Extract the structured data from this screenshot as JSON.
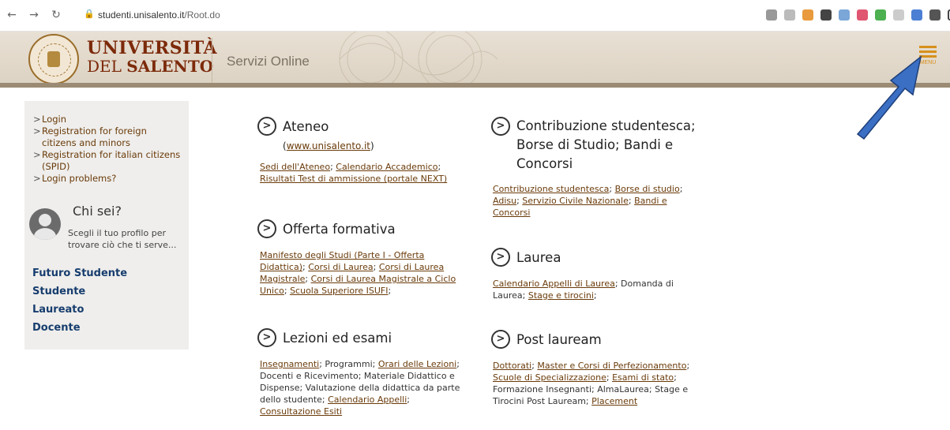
{
  "browser": {
    "url_host": "studenti.unisalento.it",
    "url_path": "/Root.do"
  },
  "header": {
    "uni_line1": "UNIVERSITÀ",
    "uni_line2_a": "DEL ",
    "uni_line2_b": "SALENTO",
    "service": "Servizi Online",
    "menu_label": "MENU"
  },
  "sidebar": {
    "links": [
      "Login",
      "Registration for foreign citizens and minors",
      "Registration for italian citizens (SPID)",
      "Login problems?"
    ],
    "chisei_title": "Chi sei?",
    "chisei_sub": "Scegli il tuo profilo per trovare ciò che ti serve...",
    "roles": [
      "Futuro Studente",
      "Studente",
      "Laureato",
      "Docente"
    ]
  },
  "sections": {
    "ateneo": {
      "title": "Ateneo",
      "subtitle_link": "www.unisalento.it",
      "l1": "Sedi dell'Ateneo",
      "l2": "Calendario Accademico",
      "l3": "Risultati Test di ammissione (portale NEXT)"
    },
    "offerta": {
      "title": "Offerta formativa",
      "l1": "Manifesto degli Studi (Parte I - Offerta Didattica)",
      "l2": "Corsi di Laurea",
      "l3": "Corsi di Laurea Magistrale",
      "l4": "Corsi di Laurea Magistrale a Ciclo Unico",
      "l5": "Scuola Superiore ISUFI"
    },
    "lezioni": {
      "title": "Lezioni ed esami",
      "l1": "Insegnamenti",
      "t1": "; Programmi; ",
      "l2": "Orari delle Lezioni",
      "t2": "; Docenti e Ricevimento; Materiale Didattico e Dispense; Valutazione della didattica da parte dello studente; ",
      "l3": "Calendario Appelli",
      "l4": "Consultazione Esiti"
    },
    "contribuzione": {
      "title": "Contribuzione studentesca; Borse di Studio; Bandi e Concorsi",
      "l1": "Contribuzione studentesca",
      "l2": "Borse di studio",
      "l3": "Adisu",
      "l4": "Servizio Civile Nazionale",
      "l5": "Bandi e Concorsi"
    },
    "laurea": {
      "title": "Laurea",
      "l1": "Calendario Appelli di Laurea",
      "t1": "; Domanda di Laurea; ",
      "l2": "Stage e tirocini"
    },
    "post": {
      "title": "Post lauream",
      "l1": "Dottorati",
      "l2": "Master e Corsi di Perfezionamento",
      "l3": "Scuole di Specializzazione",
      "l4": "Esami di stato",
      "t1": "Formazione Insegnanti; AlmaLaurea; Stage e Tirocini Post Lauream; ",
      "l5": "Placement"
    }
  },
  "colors": {
    "brand": "#7c2a0a",
    "link": "#6a3b0a",
    "menu": "#d7901c",
    "role": "#173d6e",
    "arrow": "#3a6fc4"
  }
}
